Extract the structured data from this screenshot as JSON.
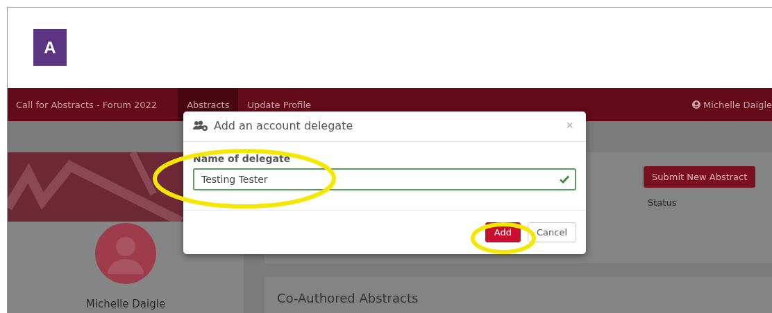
{
  "figure_label": "A",
  "navbar": {
    "brand": "Call for Abstracts - Forum 2022",
    "tabs": [
      {
        "label": "Abstracts",
        "selected": true
      },
      {
        "label": "Update Profile",
        "selected": false
      }
    ],
    "user": "Michelle Daigle"
  },
  "profile": {
    "name": "Michelle Daigle"
  },
  "abstracts": {
    "submit_button": "Submit New Abstract",
    "column": "Status"
  },
  "co_authored": {
    "title": "Co-Authored Abstracts"
  },
  "modal": {
    "title": "Add an account delegate",
    "close": "×",
    "field": {
      "label": "Name of delegate",
      "value": "Testing Tester",
      "valid": true
    },
    "buttons": [
      {
        "label": "Add",
        "kind": "primary"
      },
      {
        "label": "Cancel",
        "kind": "default"
      }
    ]
  }
}
